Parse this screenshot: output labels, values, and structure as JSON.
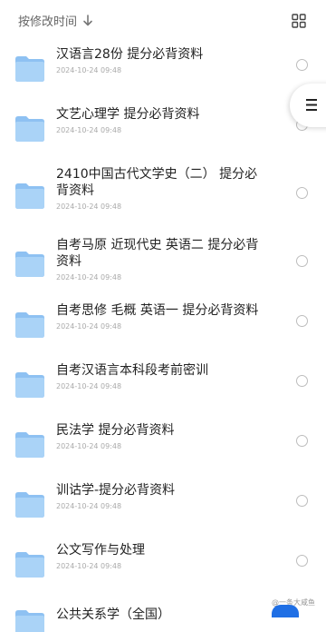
{
  "toolbar": {
    "sort_label": "按修改时间",
    "sort_icon": "arrow-down-icon",
    "view_icon": "grid-view-icon"
  },
  "files": [
    {
      "name": "汉语言28份 提分必背资料",
      "date": "2024-10-24 09:48"
    },
    {
      "name": "文艺心理学 提分必背资料",
      "date": "2024-10-24 09:48"
    },
    {
      "name": "2410中国古代文学史（二） 提分必背资料",
      "date": "2024-10-24 09:48"
    },
    {
      "name": "自考马原 近现代史 英语二  提分必背资料",
      "date": "2024-10-24 09:48"
    },
    {
      "name": "自考思修 毛概 英语一  提分必背资料",
      "date": "2024-10-24 09:48"
    },
    {
      "name": "自考汉语言本科段考前密训",
      "date": "2024-10-24 09:48"
    },
    {
      "name": "民法学 提分必背资料",
      "date": "2024-10-24 09:48"
    },
    {
      "name": "训诂学-提分必背资料",
      "date": "2024-10-24 09:48"
    },
    {
      "name": "公文写作与处理",
      "date": "2024-10-24 09:48"
    },
    {
      "name": "公共关系学（全国）",
      "date": ""
    }
  ],
  "watermark": "@一条大咸鱼",
  "colors": {
    "folder_back": "#8ec1f2",
    "folder_front": "#aad3f7",
    "accent_blue": "#1f6fe5"
  }
}
